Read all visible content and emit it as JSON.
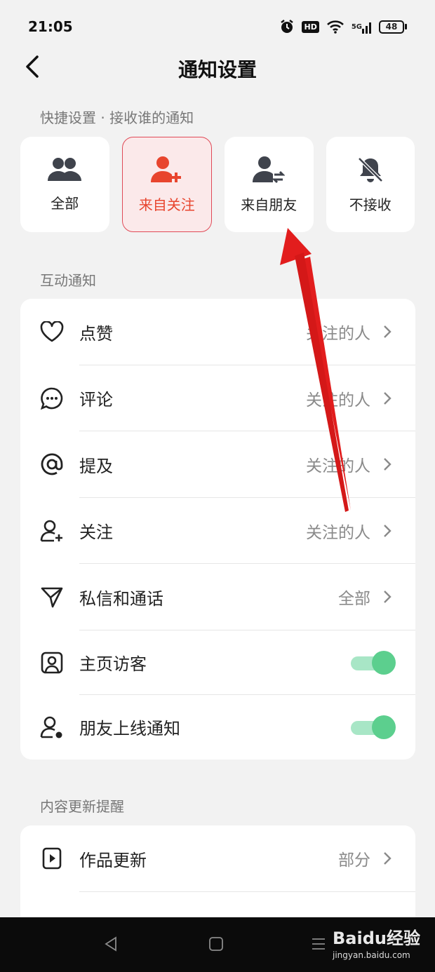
{
  "status_bar": {
    "time": "21:05",
    "hd": "HD",
    "network": "5G",
    "battery": "48"
  },
  "header": {
    "title": "通知设置"
  },
  "quick_settings": {
    "label": "快捷设置 · 接收谁的通知",
    "options": [
      {
        "label": "全部",
        "icon": "users-icon",
        "selected": false
      },
      {
        "label": "来自关注",
        "icon": "user-add-icon",
        "selected": true
      },
      {
        "label": "来自朋友",
        "icon": "user-exchange-icon",
        "selected": false
      },
      {
        "label": "不接收",
        "icon": "bell-off-icon",
        "selected": false
      }
    ]
  },
  "interaction": {
    "label": "互动通知",
    "items": [
      {
        "label": "点赞",
        "value": "关注的人",
        "icon": "heart-icon"
      },
      {
        "label": "评论",
        "value": "关注的人",
        "icon": "comment-icon"
      },
      {
        "label": "提及",
        "value": "关注的人",
        "icon": "at-icon"
      },
      {
        "label": "关注",
        "value": "关注的人",
        "icon": "follow-icon"
      },
      {
        "label": "私信和通话",
        "value": "全部",
        "icon": "send-icon"
      },
      {
        "label": "主页访客",
        "toggle": true,
        "icon": "profile-icon"
      },
      {
        "label": "朋友上线通知",
        "toggle": true,
        "icon": "user-online-icon"
      }
    ]
  },
  "content_updates": {
    "label": "内容更新提醒",
    "items": [
      {
        "label": "作品更新",
        "value": "部分",
        "icon": "video-icon"
      }
    ]
  },
  "watermark": {
    "logo": "Baidu经验",
    "sub": "jingyan.baidu.com"
  },
  "colors": {
    "accent": "#e8452e",
    "toggle_on": "#5ccf8e",
    "annotation_arrow": "#e21d1d"
  }
}
